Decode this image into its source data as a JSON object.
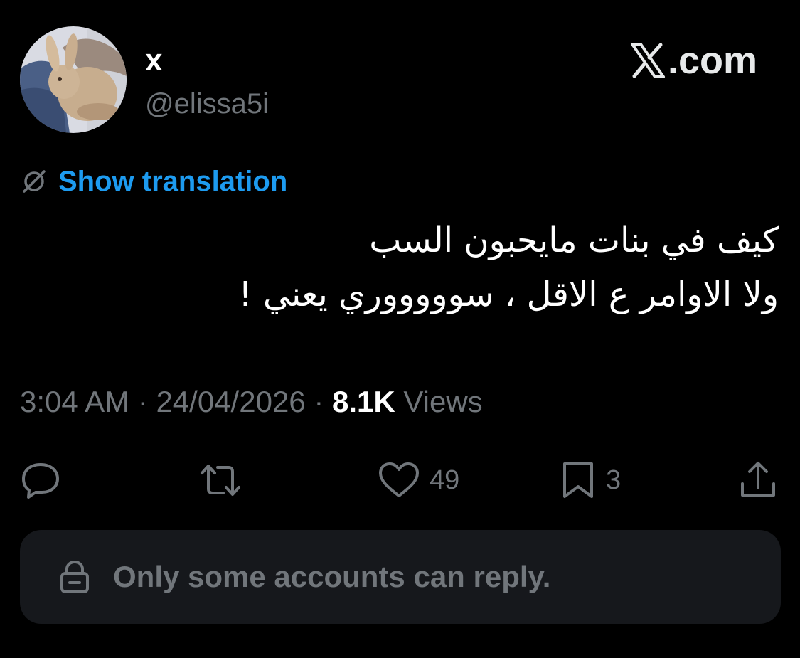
{
  "author": {
    "display_name": "x",
    "handle": "@elissa5i",
    "avatar_icon": "profile-photo-rabbit"
  },
  "brand": {
    "logo_icon": "x-logo-icon",
    "suffix": ".com"
  },
  "translation": {
    "icon": "globe-slash-icon",
    "label": "Show translation",
    "color": "#1d9bf0"
  },
  "tweet": {
    "lines": [
      "كيف في بنات مايحبون السب",
      "ولا الاوامر ع الاقل ، سوووووري يعني !"
    ]
  },
  "meta": {
    "time": "3:04 AM",
    "separator": "·",
    "date": "24/04/2026",
    "views_count": "8.1K",
    "views_label": "Views"
  },
  "actions": {
    "reply": {
      "icon": "reply-icon",
      "count": ""
    },
    "retweet": {
      "icon": "retweet-icon",
      "count": ""
    },
    "like": {
      "icon": "heart-icon",
      "count": "49"
    },
    "bookmark": {
      "icon": "bookmark-icon",
      "count": "3"
    },
    "share": {
      "icon": "share-icon",
      "count": ""
    }
  },
  "reply_restriction": {
    "icon": "lock-icon",
    "text": "Only some accounts can reply."
  },
  "colors": {
    "background": "#000000",
    "text_primary": "#ffffff",
    "text_secondary": "#71767b",
    "accent_blue": "#1d9bf0",
    "banner_bg": "#16181c"
  }
}
